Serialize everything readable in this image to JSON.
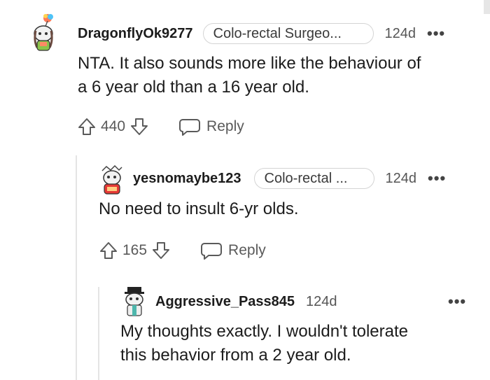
{
  "comments": [
    {
      "username": "DragonflyOk9277",
      "flair": "Colo-rectal Surgeo...",
      "time": "124d",
      "more": "•••",
      "body": [
        "NTA. It also sounds more like the behaviour of",
        "a 6 year old than a 16 year old."
      ],
      "score": "440",
      "reply": "Reply"
    },
    {
      "username": "yesnomaybe123",
      "flair": "Colo-rectal ...",
      "time": "124d",
      "more": "•••",
      "body": [
        "No need to insult 6-yr olds."
      ],
      "score": "165",
      "reply": "Reply"
    },
    {
      "username": "Aggressive_Pass845",
      "time": "124d",
      "more": "•••",
      "body": [
        "My thoughts exactly. I wouldn't tolerate",
        "this behavior from a 2 year old."
      ]
    }
  ],
  "icons": {
    "upvote": "arrow-up-icon",
    "downvote": "arrow-down-icon",
    "reply": "speech-bubble-icon",
    "more": "ellipsis-icon"
  }
}
